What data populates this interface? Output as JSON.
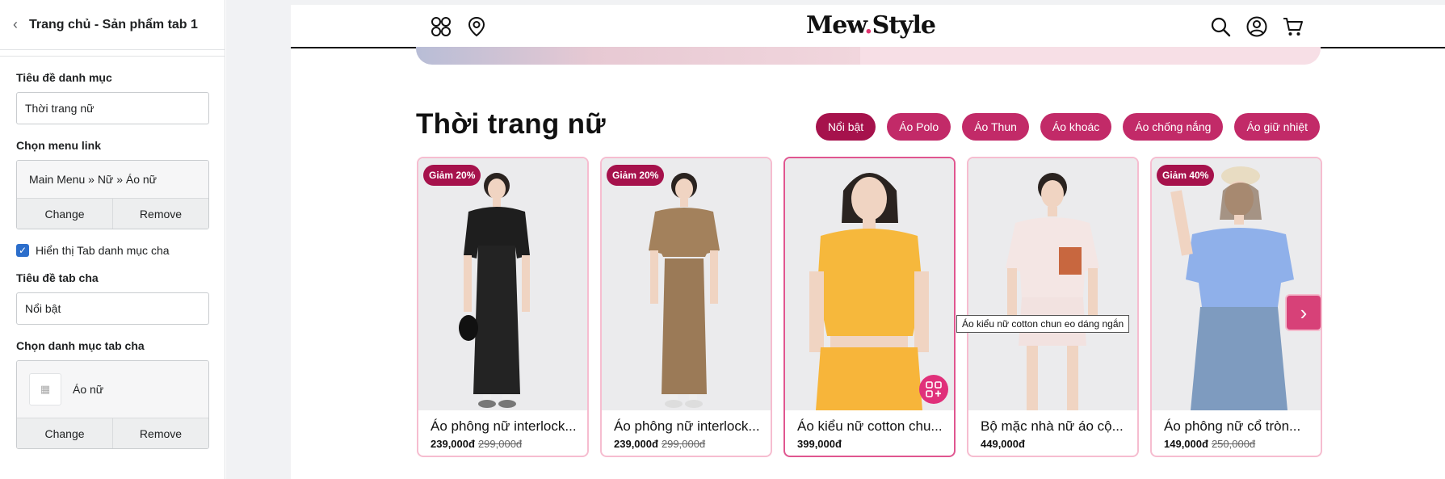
{
  "panel": {
    "title": "Trang chủ - Sản phẩm tab 1",
    "category_title_label": "Tiêu đề danh mục",
    "category_title_value": "Thời trang nữ",
    "menu_link_label": "Chọn menu link",
    "menu_link_value": "Main Menu » Nữ » Áo nữ",
    "change_label": "Change",
    "remove_label": "Remove",
    "show_parent_tab_label": "Hiển thị Tab danh mục cha",
    "parent_tab_title_label": "Tiêu đề tab cha",
    "parent_tab_title_value": "Nổi bật",
    "parent_tab_category_label": "Chọn danh mục tab cha",
    "parent_tab_category_value": "Áo nữ"
  },
  "store": {
    "logo_main": "Mew",
    "logo_dot": ".",
    "logo_tail": "Style"
  },
  "section": {
    "title": "Thời trang nữ",
    "tabs": [
      "Nổi bật",
      "Áo Polo",
      "Áo Thun",
      "Áo khoác",
      "Áo chống nắng",
      "Áo giữ nhiệt"
    ]
  },
  "products": [
    {
      "badge": "Giảm 20%",
      "name": "Áo phông nữ interlock...",
      "price": "239,000đ",
      "old_price": "299,000đ"
    },
    {
      "badge": "Giảm 20%",
      "name": "Áo phông nữ interlock...",
      "price": "239,000đ",
      "old_price": "299,000đ"
    },
    {
      "badge": "",
      "name": "Áo kiểu nữ cotton chu...",
      "price": "399,000đ",
      "old_price": ""
    },
    {
      "badge": "",
      "name": "Bộ mặc nhà nữ áo cộ...",
      "price": "449,000đ",
      "old_price": ""
    },
    {
      "badge": "Giảm 40%",
      "name": "Áo phông nữ cổ tròn...",
      "price": "149,000đ",
      "old_price": "250,000đ"
    }
  ],
  "tooltip": "Áo kiểu nữ cotton chun eo dáng ngắn",
  "colors": {
    "accent": "#c22a68",
    "accent_dark": "#a6124c",
    "card_border": "#f6bdd0",
    "checkbox": "#2c6ecb"
  }
}
